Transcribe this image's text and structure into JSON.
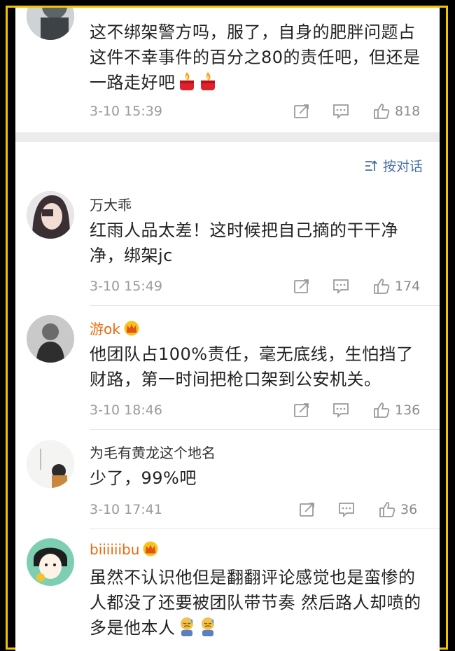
{
  "comments": [
    {
      "id": "c0",
      "text": "这不绑架警方吗，服了，自身的肥胖问题占这件不幸事件的百分之80的责任吧，但还是一路走好吧",
      "time": "3-10 15:39",
      "likes": "818"
    },
    {
      "id": "c1",
      "user": "万大乖",
      "text": "红雨人品太差！这时候把自己摘的干干净净，绑架jc",
      "time": "3-10 15:49",
      "likes": "174"
    },
    {
      "id": "c2",
      "user": "游ok",
      "text": "他团队占100%责任，毫无底线，生怕挡了财路，第一时间把枪口架到公安机关。",
      "time": "3-10 18:46",
      "likes": "136"
    },
    {
      "id": "c3",
      "user": "为毛有黄龙这个地名",
      "text": "少了，99%吧",
      "time": "3-10 17:41",
      "likes": "36"
    },
    {
      "id": "c4",
      "user": "biiiiiibu",
      "text": "虽然不认识他但是翻翻评论感觉也是蛮惨的人都没了还要被团队带节奏 然后路人却喷的多是他本人",
      "time": "",
      "likes": ""
    }
  ],
  "reply_toggle": {
    "label": "按对话"
  },
  "colors": {
    "vip_name": "#e86b10",
    "text": "#222222",
    "meta": "#9a9a9a",
    "frame": "#f2c400"
  },
  "icons": [
    "repost-icon",
    "comment-icon",
    "like-icon",
    "candle-emoji",
    "crown-badge-icon",
    "sweat-emoji",
    "dialog-sort-icon"
  ]
}
